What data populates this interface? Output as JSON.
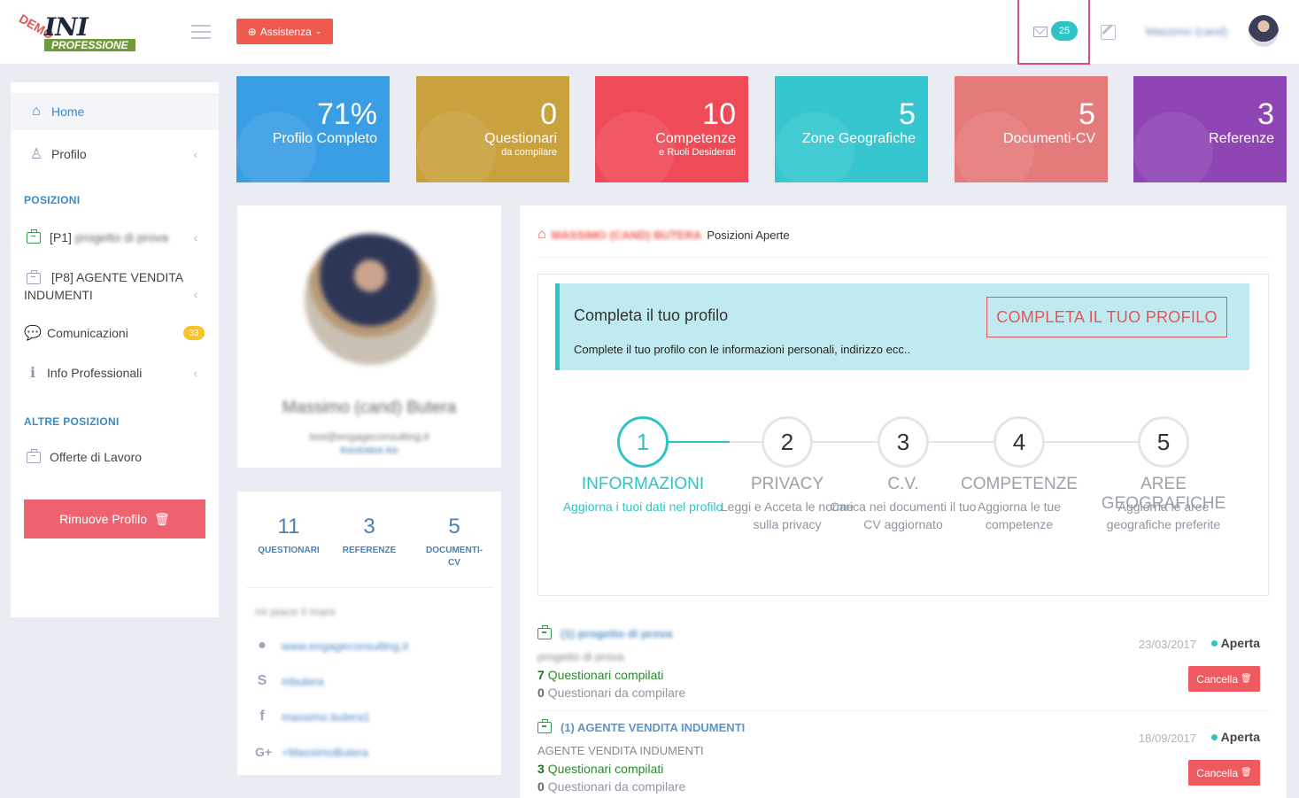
{
  "header": {
    "logo_title": "INI",
    "logo_subtitle": "PROFESSIONE",
    "logo_stamp": "DEMO",
    "assist_label": "Assistenza",
    "mail_count": "25",
    "user_name": "Massimo (cand)"
  },
  "sidebar": {
    "home": "Home",
    "profile": "Profilo",
    "section_positions": "POSIZIONI",
    "p1_code": "[P1]",
    "p1_name": "progetto di prova",
    "p8_label": "[P8] AGENTE VENDITA INDUMENTI",
    "communications": "Comunicazioni",
    "communications_count": "33",
    "info": "Info Professionali",
    "section_other": "ALTRE POSIZIONI",
    "offers": "Offerte di Lavoro",
    "remove_button": "Rimuove Profilo"
  },
  "tiles": [
    {
      "value": "71%",
      "label": "Profilo Completo",
      "sub": "",
      "color": "#3a9ee4"
    },
    {
      "value": "0",
      "label": "Questionari",
      "sub": "da compilare",
      "color": "#c9a13f"
    },
    {
      "value": "10",
      "label": "Competenze",
      "sub": "e Ruoli Desiderati",
      "color": "#ee4a57"
    },
    {
      "value": "5",
      "label": "Zone Geografiche",
      "sub": "",
      "color": "#35c6cf"
    },
    {
      "value": "5",
      "label": "Documenti-CV",
      "sub": "",
      "color": "#e57a7a"
    },
    {
      "value": "3",
      "label": "Referenze",
      "sub": "",
      "color": "#8f45b3"
    }
  ],
  "profile": {
    "name": "Massimo (cand) Butera",
    "email": "test@engageconsulting.it",
    "location": "RAVENNA RA"
  },
  "stats": {
    "questionari_n": "11",
    "questionari_l": "QUESTIONARI",
    "referenze_n": "3",
    "referenze_l": "REFERENZE",
    "documenti_n": "5",
    "documenti_l": "DOCUMENTI-CV"
  },
  "about": {
    "bio": "mi piace il mare",
    "website": "www.engageconsulting.it",
    "skype": "mbutera",
    "facebook": "massimo.butera1",
    "gplus": "+MassimoButera"
  },
  "main": {
    "crumb_user": "MASSIMO (CAND) BUTERA",
    "crumb_page": "Posizioni Aperte",
    "alert_title": "Completa il tuo profilo",
    "alert_text": "Complete il tuo profilo con le informazioni personali, indirizzo ecc..",
    "alert_button": "COMPLETA IL TUO PROFILO",
    "steps": [
      {
        "n": "1",
        "title": "INFORMAZIONI",
        "desc": "Aggiorna i tuoi dati nel profilo"
      },
      {
        "n": "2",
        "title": "PRIVACY",
        "desc": "Leggi e Acceta le norme sulla privacy"
      },
      {
        "n": "3",
        "title": "C.V.",
        "desc": "Carica nei documenti il tuo CV aggiornato"
      },
      {
        "n": "4",
        "title": "COMPETENZE",
        "desc": "Aggiorna le tue competenze"
      },
      {
        "n": "5",
        "title": "AREE GEOGRAFICHE",
        "desc": "Aggiorna le aree geografiche preferite"
      }
    ],
    "positions": [
      {
        "title": "(1) progetto di prova",
        "subtitle": "progetto di prova",
        "completed": "7",
        "completed_label": "Questionari compilati",
        "todo": "0",
        "todo_label": "Questionari da compilare",
        "date": "23/03/2017",
        "state": "Aperta",
        "cancel": "Cancella"
      },
      {
        "title": "(1) AGENTE VENDITA INDUMENTI",
        "subtitle": "AGENTE VENDITA INDUMENTI",
        "completed": "3",
        "completed_label": "Questionari compilati",
        "todo": "0",
        "todo_label": "Questionari da compilare",
        "date": "18/09/2017",
        "state": "Aperta",
        "cancel": "Cancella"
      }
    ]
  },
  "colors": {
    "accent": "#2ec4c6",
    "danger": "#ef5a4f",
    "link": "#3a87c9"
  }
}
